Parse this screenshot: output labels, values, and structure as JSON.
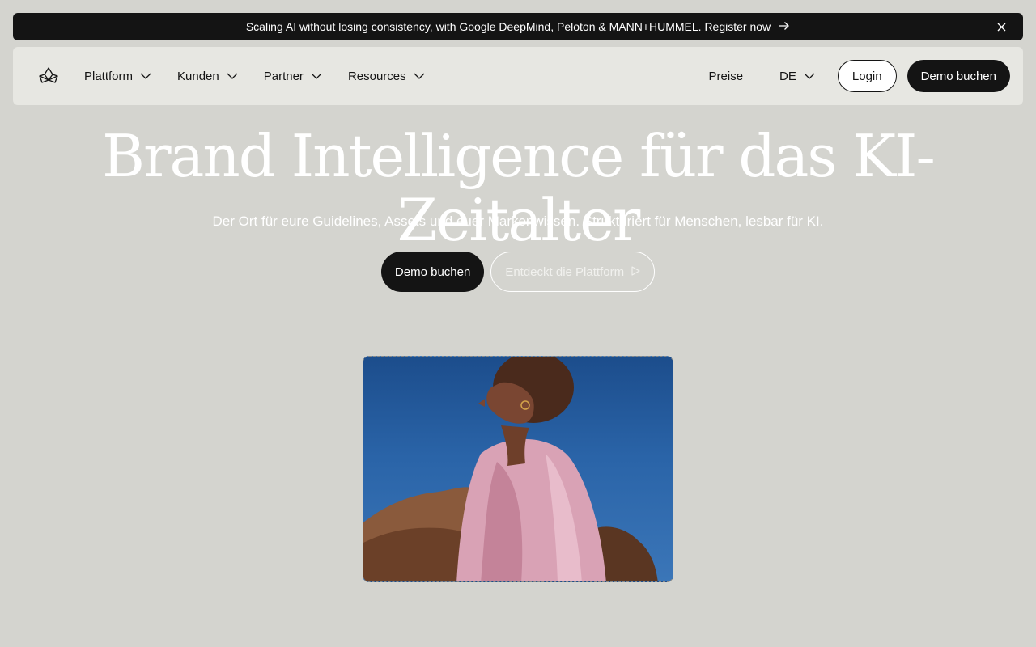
{
  "announcement": {
    "text": "Scaling AI without losing consistency, with Google DeepMind, Peloton & MANN+HUMMEL. Register now",
    "arrow_icon": "arrow-right-icon",
    "close_icon": "close-icon"
  },
  "nav": {
    "menu": [
      {
        "label": "Plattform"
      },
      {
        "label": "Kunden"
      },
      {
        "label": "Partner"
      },
      {
        "label": "Resources"
      }
    ],
    "pricing": "Preise",
    "language": "DE",
    "login": "Login",
    "demo": "Demo buchen"
  },
  "hero": {
    "title": "Brand Intelligence für das KI-Zeitalter",
    "subtitle": "Der Ort für eure Guidelines, Assets und euer Markenwissen. Strukturiert für Menschen, lesbar für KI.",
    "cta_primary": "Demo buchen",
    "cta_secondary": "Entdeckt die Plattform"
  },
  "colors": {
    "background": "#d4d4cf",
    "nav_bg": "#e7e7e2",
    "dark": "#141414",
    "hero_text": "#ffffff"
  }
}
